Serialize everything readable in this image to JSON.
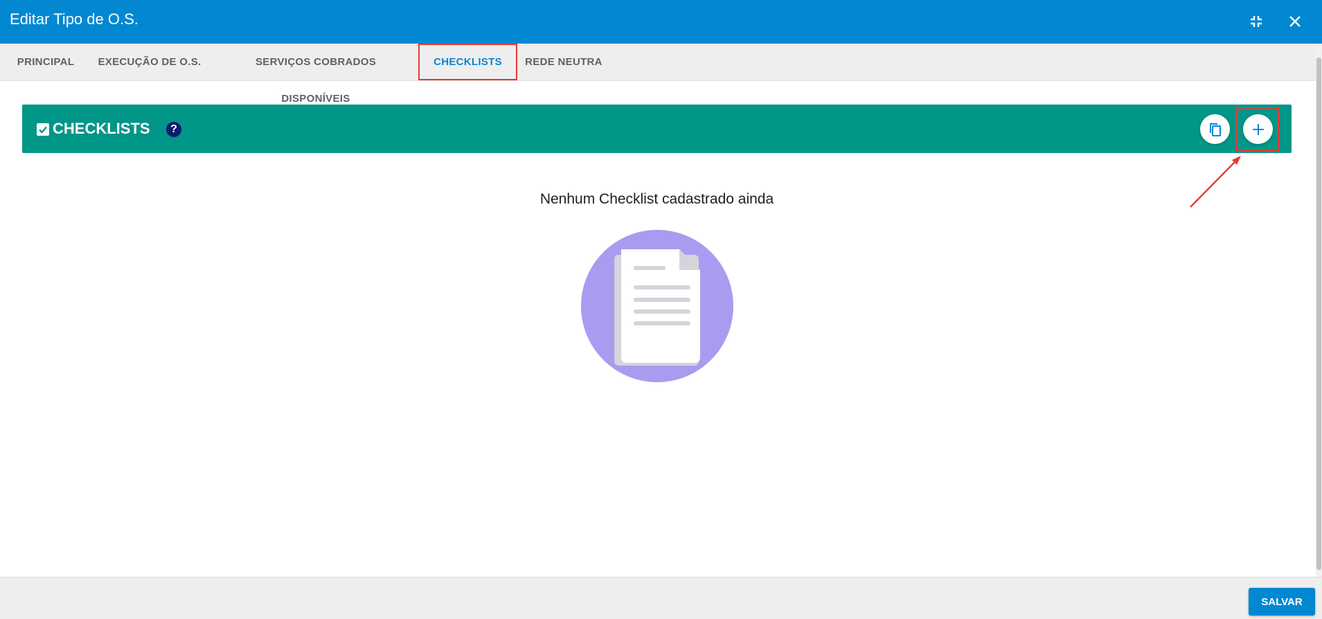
{
  "window": {
    "title": "Editar Tipo de O.S."
  },
  "tabs": [
    {
      "label": "PRINCIPAL",
      "active": false
    },
    {
      "label": "EXECUÇÃO DE O.S.",
      "active": false
    },
    {
      "label": "SERVIÇOS COBRADOS DISPONÍVEIS",
      "active": false
    },
    {
      "label": "CHECKLISTS",
      "active": true
    },
    {
      "label": "REDE NEUTRA",
      "active": false
    }
  ],
  "section": {
    "title": "CHECKLISTS",
    "help_icon": "?"
  },
  "empty_state": {
    "message": "Nenhum Checklist cadastrado ainda"
  },
  "footer": {
    "save_label": "SALVAR"
  },
  "colors": {
    "primary": "#0288d1",
    "section_header": "#009688",
    "highlight": "#e53935",
    "illustration_circle": "#a89cf0"
  },
  "icons": {
    "minimize": "collapse-icon",
    "close": "close-icon",
    "copy": "copy-icon",
    "add": "plus-icon"
  }
}
